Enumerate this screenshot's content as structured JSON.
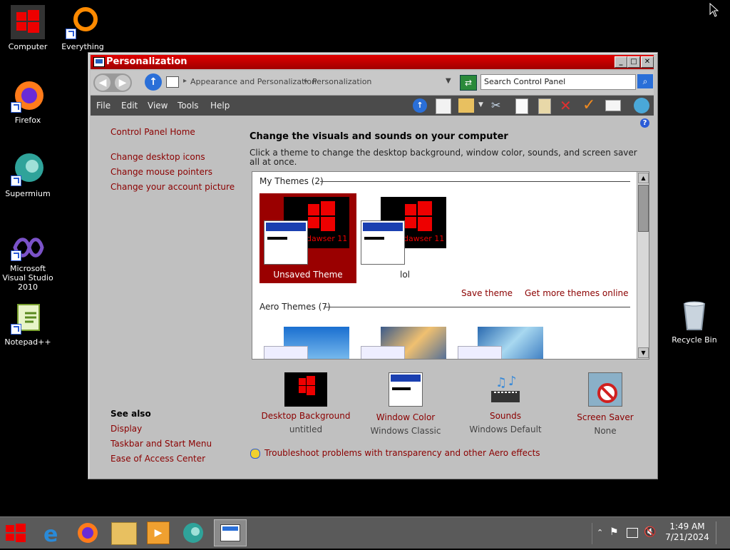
{
  "desktop": {
    "icons": [
      {
        "label": "Computer"
      },
      {
        "label": "Everything"
      },
      {
        "label": "Firefox"
      },
      {
        "label": "Supermium"
      },
      {
        "label": "Microsoft Visual Studio 2010"
      },
      {
        "label": "Notepad++"
      },
      {
        "label": "Recycle Bin"
      }
    ]
  },
  "window": {
    "title": "Personalization",
    "breadcrumb": [
      "Appearance and Personalization",
      "Personalization"
    ],
    "search_placeholder": "Search Control Panel",
    "menu": [
      "File",
      "Edit",
      "View",
      "Tools",
      "Help"
    ]
  },
  "sidebar": {
    "home": "Control Panel Home",
    "links": [
      "Change desktop icons",
      "Change mouse pointers",
      "Change your account picture"
    ],
    "see_also_title": "See also",
    "see_also": [
      "Display",
      "Taskbar and Start Menu",
      "Ease of Access Center"
    ]
  },
  "main": {
    "heading": "Change the visuals and sounds on your computer",
    "description": "Click a theme to change the desktop background, window color, sounds, and screen saver all at once.",
    "my_themes_label": "My Themes (2)",
    "themes": [
      {
        "name": "Unsaved Theme",
        "watermark": "dawser 11"
      },
      {
        "name": "lol",
        "watermark": "dawser 11"
      }
    ],
    "save_theme": "Save theme",
    "get_more": "Get more themes online",
    "aero_themes_label": "Aero Themes (7)",
    "settings": [
      {
        "title": "Desktop Background",
        "value": "untitled"
      },
      {
        "title": "Window Color",
        "value": "Windows Classic"
      },
      {
        "title": "Sounds",
        "value": "Windows Default"
      },
      {
        "title": "Screen Saver",
        "value": "None"
      }
    ],
    "troubleshoot": "Troubleshoot problems with transparency and other Aero effects"
  },
  "taskbar": {
    "time": "1:49 AM",
    "date": "7/21/2024"
  },
  "colors": {
    "accent": "#cc0000",
    "link": "#8b0000",
    "window_bg": "#c0c0c0"
  }
}
